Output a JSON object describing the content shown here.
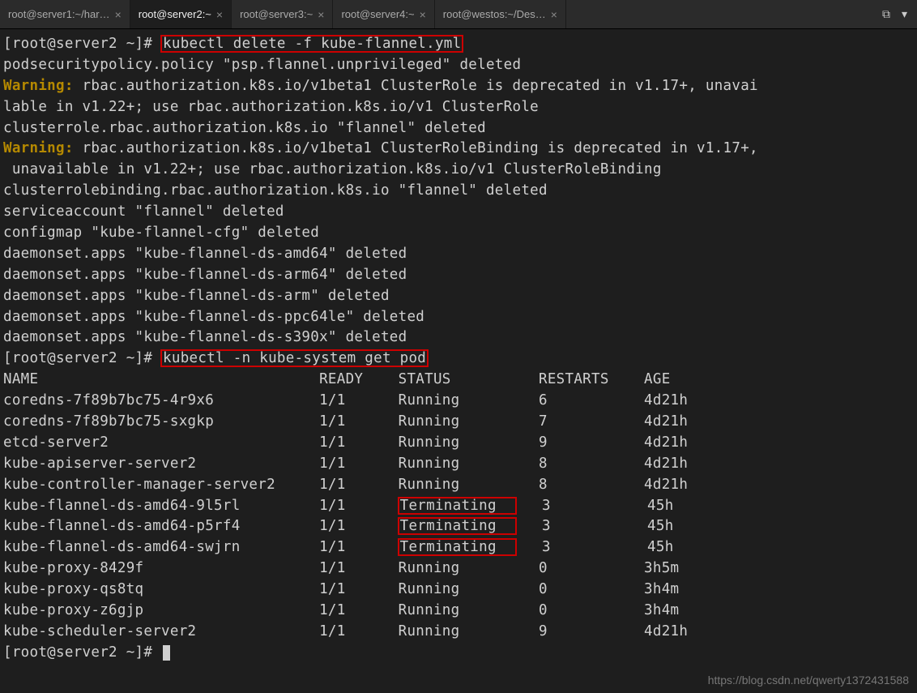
{
  "tabs": [
    {
      "label": "root@server1:~/har…",
      "active": false
    },
    {
      "label": "root@server2:~",
      "active": true
    },
    {
      "label": "root@server3:~",
      "active": false
    },
    {
      "label": "root@server4:~",
      "active": false
    },
    {
      "label": "root@westos:~/Des…",
      "active": false
    }
  ],
  "toolbar": {
    "screen_icon": "⧉",
    "menu_icon": "▾"
  },
  "prompt1": "[root@server2 ~]# ",
  "cmd1": "kubectl delete -f kube-flannel.yml",
  "out_lines": [
    "podsecuritypolicy.policy \"psp.flannel.unprivileged\" deleted"
  ],
  "warn1_label": "Warning:",
  "warn1_text": " rbac.authorization.k8s.io/v1beta1 ClusterRole is deprecated in v1.17+, unavai\nlable in v1.22+; use rbac.authorization.k8s.io/v1 ClusterRole",
  "out_lines2": [
    "clusterrole.rbac.authorization.k8s.io \"flannel\" deleted"
  ],
  "warn2_label": "Warning:",
  "warn2_text": " rbac.authorization.k8s.io/v1beta1 ClusterRoleBinding is deprecated in v1.17+,\n unavailable in v1.22+; use rbac.authorization.k8s.io/v1 ClusterRoleBinding",
  "out_lines3": [
    "clusterrolebinding.rbac.authorization.k8s.io \"flannel\" deleted",
    "serviceaccount \"flannel\" deleted",
    "configmap \"kube-flannel-cfg\" deleted",
    "daemonset.apps \"kube-flannel-ds-amd64\" deleted",
    "daemonset.apps \"kube-flannel-ds-arm64\" deleted",
    "daemonset.apps \"kube-flannel-ds-arm\" deleted",
    "daemonset.apps \"kube-flannel-ds-ppc64le\" deleted",
    "daemonset.apps \"kube-flannel-ds-s390x\" deleted"
  ],
  "prompt2": "[root@server2 ~]# ",
  "cmd2": "kubectl -n kube-system get pod",
  "table_header": {
    "name": "NAME",
    "ready": "READY",
    "status": "STATUS",
    "restarts": "RESTARTS",
    "age": "AGE"
  },
  "pods": [
    {
      "name": "coredns-7f89b7bc75-4r9x6",
      "ready": "1/1",
      "status": "Running",
      "restarts": "6",
      "age": "4d21h",
      "term": false
    },
    {
      "name": "coredns-7f89b7bc75-sxgkp",
      "ready": "1/1",
      "status": "Running",
      "restarts": "7",
      "age": "4d21h",
      "term": false
    },
    {
      "name": "etcd-server2",
      "ready": "1/1",
      "status": "Running",
      "restarts": "9",
      "age": "4d21h",
      "term": false
    },
    {
      "name": "kube-apiserver-server2",
      "ready": "1/1",
      "status": "Running",
      "restarts": "8",
      "age": "4d21h",
      "term": false
    },
    {
      "name": "kube-controller-manager-server2",
      "ready": "1/1",
      "status": "Running",
      "restarts": "8",
      "age": "4d21h",
      "term": false
    },
    {
      "name": "kube-flannel-ds-amd64-9l5rl",
      "ready": "1/1",
      "status": "Terminating",
      "restarts": "3",
      "age": "45h",
      "term": true
    },
    {
      "name": "kube-flannel-ds-amd64-p5rf4",
      "ready": "1/1",
      "status": "Terminating",
      "restarts": "3",
      "age": "45h",
      "term": true
    },
    {
      "name": "kube-flannel-ds-amd64-swjrn",
      "ready": "1/1",
      "status": "Terminating",
      "restarts": "3",
      "age": "45h",
      "term": true
    },
    {
      "name": "kube-proxy-8429f",
      "ready": "1/1",
      "status": "Running",
      "restarts": "0",
      "age": "3h5m",
      "term": false
    },
    {
      "name": "kube-proxy-qs8tq",
      "ready": "1/1",
      "status": "Running",
      "restarts": "0",
      "age": "3h4m",
      "term": false
    },
    {
      "name": "kube-proxy-z6gjp",
      "ready": "1/1",
      "status": "Running",
      "restarts": "0",
      "age": "3h4m",
      "term": false
    },
    {
      "name": "kube-scheduler-server2",
      "ready": "1/1",
      "status": "Running",
      "restarts": "9",
      "age": "4d21h",
      "term": false
    }
  ],
  "prompt3": "[root@server2 ~]# ",
  "watermark": "https://blog.csdn.net/qwerty1372431588",
  "cols": {
    "name": 36,
    "ready": 9,
    "status": 16,
    "restarts": 12
  }
}
